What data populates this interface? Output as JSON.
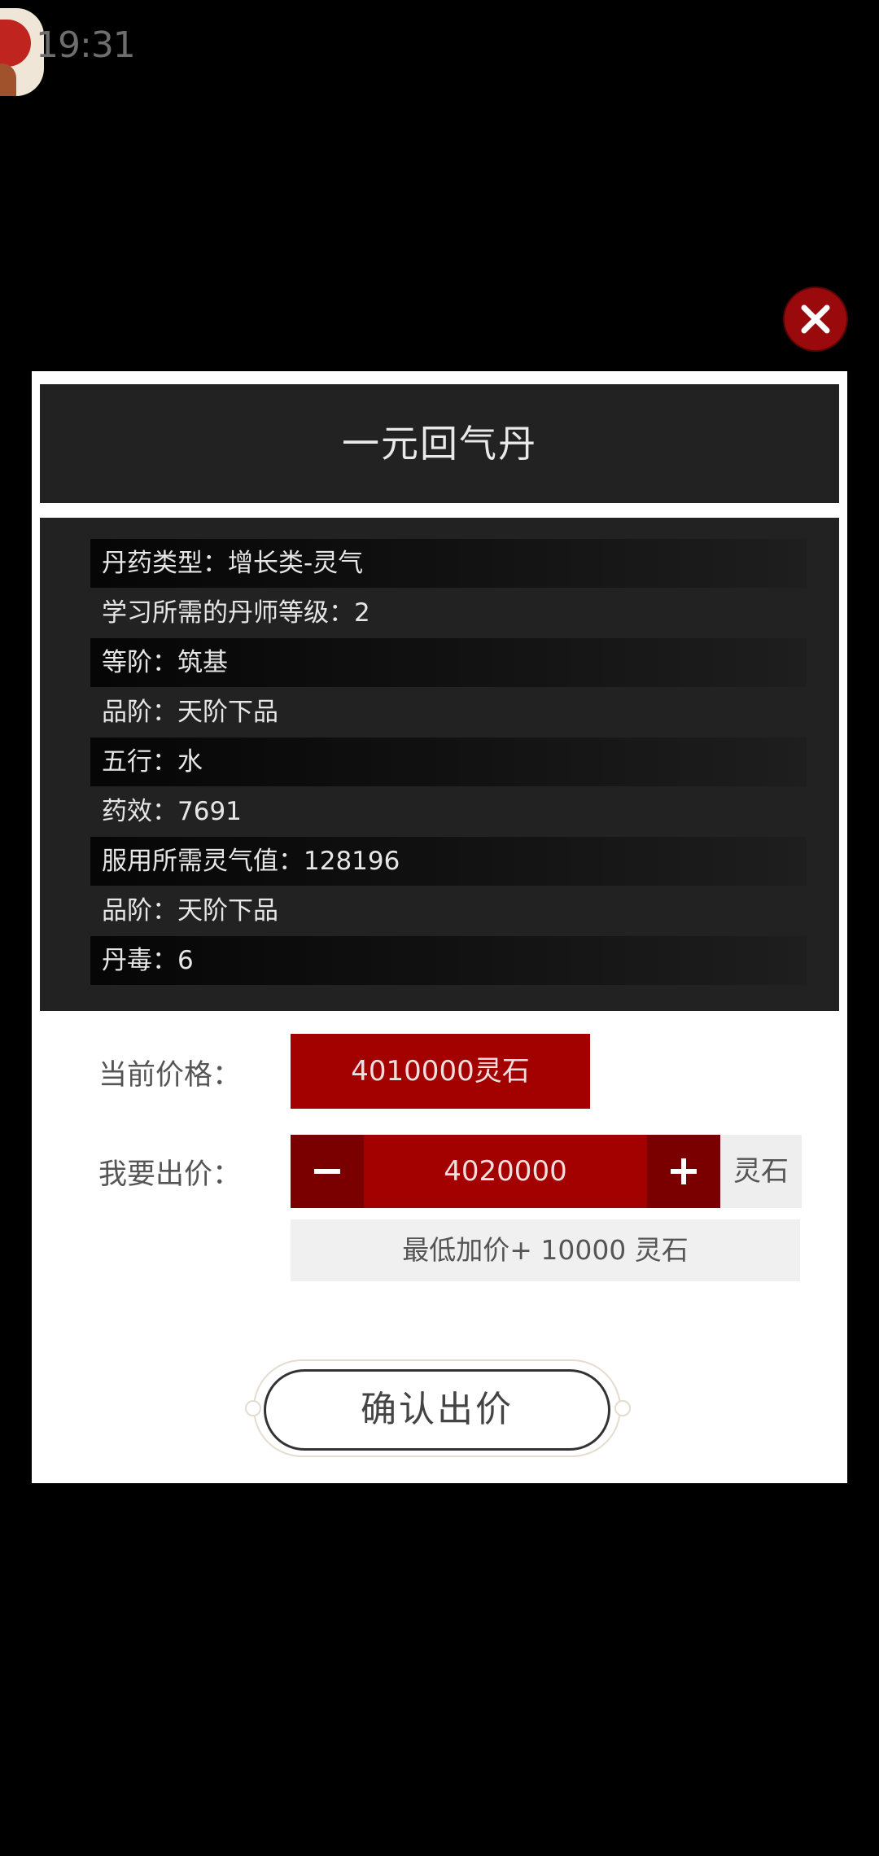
{
  "status_bar": {
    "time": "19:31"
  },
  "dialog": {
    "title": "一元回气丹",
    "info_rows": [
      {
        "text": "丹药类型：增长类-灵气"
      },
      {
        "text": "学习所需的丹师等级：2"
      },
      {
        "text": "等阶：筑基"
      },
      {
        "text": "品阶：天阶下品"
      },
      {
        "text": "五行：水"
      },
      {
        "text": "药效：7691"
      },
      {
        "text": "服用所需灵气值：128196"
      },
      {
        "text": "品阶：天阶下品"
      },
      {
        "text": "丹毒：6"
      }
    ],
    "current_price_label": "当前价格：",
    "current_price_value": "4010000灵石",
    "bid_label": "我要出价：",
    "bid_value": "4020000",
    "bid_unit": "灵石",
    "min_increment": "最低加价+ 10000 灵石",
    "confirm_label": "确认出价"
  },
  "icons": {
    "close": "close-icon",
    "minus": "minus-icon",
    "plus": "plus-icon"
  },
  "colors": {
    "accent_red": "#a30000",
    "dark_red": "#7a0000",
    "close_red": "#9a0a0c",
    "panel_dark": "#222222"
  }
}
